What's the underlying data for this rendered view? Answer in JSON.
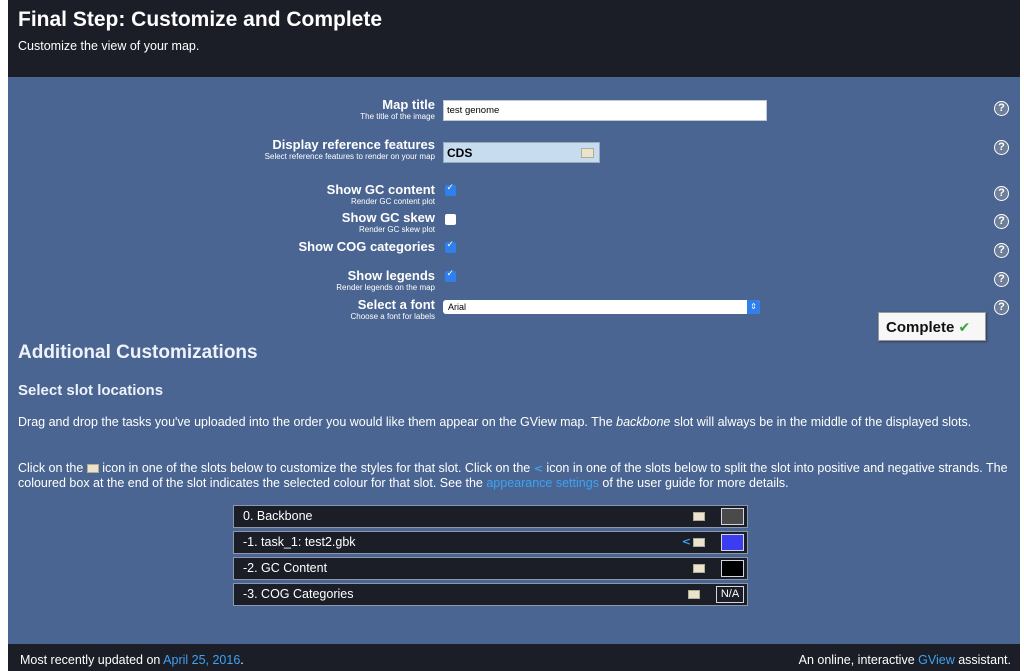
{
  "header": {
    "title": "Final Step: Customize and Complete",
    "subtitle": "Customize the view of your map."
  },
  "form": {
    "map_title": {
      "label": "Map title",
      "hint": "The title of the image",
      "value": "test genome"
    },
    "reference_features": {
      "label": "Display reference features",
      "hint": "Select reference features to render on your map",
      "value": "CDS"
    },
    "gc_content": {
      "label": "Show GC content",
      "hint": "Render GC content plot",
      "checked": true
    },
    "gc_skew": {
      "label": "Show GC skew",
      "hint": "Render GC skew plot",
      "checked": false
    },
    "cog_categories": {
      "label": "Show COG categories",
      "hint": "",
      "checked": true
    },
    "legends": {
      "label": "Show legends",
      "hint": "Render legends on the map",
      "checked": true
    },
    "font": {
      "label": "Select a font",
      "hint": "Choose a font for labels",
      "value": "Arial"
    },
    "help_symbol": "?"
  },
  "complete_button": {
    "label": "Complete",
    "check": "✔"
  },
  "additional": {
    "heading": "Additional Customizations",
    "subheading": "Select slot locations",
    "para1_before": "Drag and drop the tasks you've uploaded into the order you would like them appear on the GView map. The ",
    "para1_em": "backbone",
    "para1_after": " slot will always be in the middle of the displayed slots.",
    "para2_a": "Click on the ",
    "para2_b": " icon in one of the slots below to customize the styles for that slot. Click on the ",
    "para2_c": " icon in one of the slots below to split the slot into positive and negative strands. The coloured box at the end of the slot indicates the selected colour for that slot. See the ",
    "para2_link": "appearance settings",
    "para2_d": " of the user guide for more details."
  },
  "slots": [
    {
      "label": "0. Backbone",
      "color": "#4a4a4a",
      "split": false
    },
    {
      "label": "-1.  task_1: test2.gbk",
      "color": "#3c3cf0",
      "split": true
    },
    {
      "label": "-2. GC Content",
      "color": "#000000",
      "split": false
    },
    {
      "label": "-3. COG Categories",
      "na": "N/A",
      "split": false
    }
  ],
  "footer": {
    "left_text": "Most recently updated on ",
    "left_link": "April 25, 2016",
    "left_end": ".",
    "right_text": "An online, interactive ",
    "right_link": "GView",
    "right_end": " assistant."
  },
  "colors": {
    "background": "#4a6591",
    "header": "#1b1e27",
    "link": "#3fa2f2",
    "checkbox": "#2f80ed"
  }
}
